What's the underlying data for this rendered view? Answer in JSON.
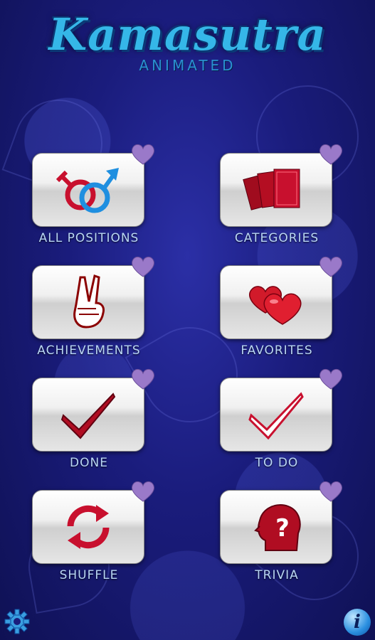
{
  "app": {
    "title": "Kamasutra",
    "subtitle": "ANIMATED"
  },
  "menu": [
    {
      "id": "all-positions",
      "label": "ALL POSITIONS",
      "icon": "gender-symbols-icon"
    },
    {
      "id": "categories",
      "label": "CATEGORIES",
      "icon": "cards-icon"
    },
    {
      "id": "achievements",
      "label": "ACHIEVEMENTS",
      "icon": "victory-hand-icon"
    },
    {
      "id": "favorites",
      "label": "FAVORITES",
      "icon": "hearts-icon"
    },
    {
      "id": "done",
      "label": "DONE",
      "icon": "checkmark-icon"
    },
    {
      "id": "to-do",
      "label": "TO DO",
      "icon": "outline-checkmark-icon"
    },
    {
      "id": "shuffle",
      "label": "SHUFFLE",
      "icon": "shuffle-arrows-icon"
    },
    {
      "id": "trivia",
      "label": "TRIVIA",
      "icon": "question-head-icon"
    }
  ],
  "footer": {
    "settings_icon": "gear-icon",
    "info_icon": "info-icon",
    "info_glyph": "i"
  },
  "colors": {
    "background": "#1a1c7c",
    "logo": "#35b7e8",
    "label": "#b9d6f5",
    "icon_red": "#c8102e",
    "icon_blue": "#1f8fe0",
    "heart_purple": "#9a79c9"
  }
}
